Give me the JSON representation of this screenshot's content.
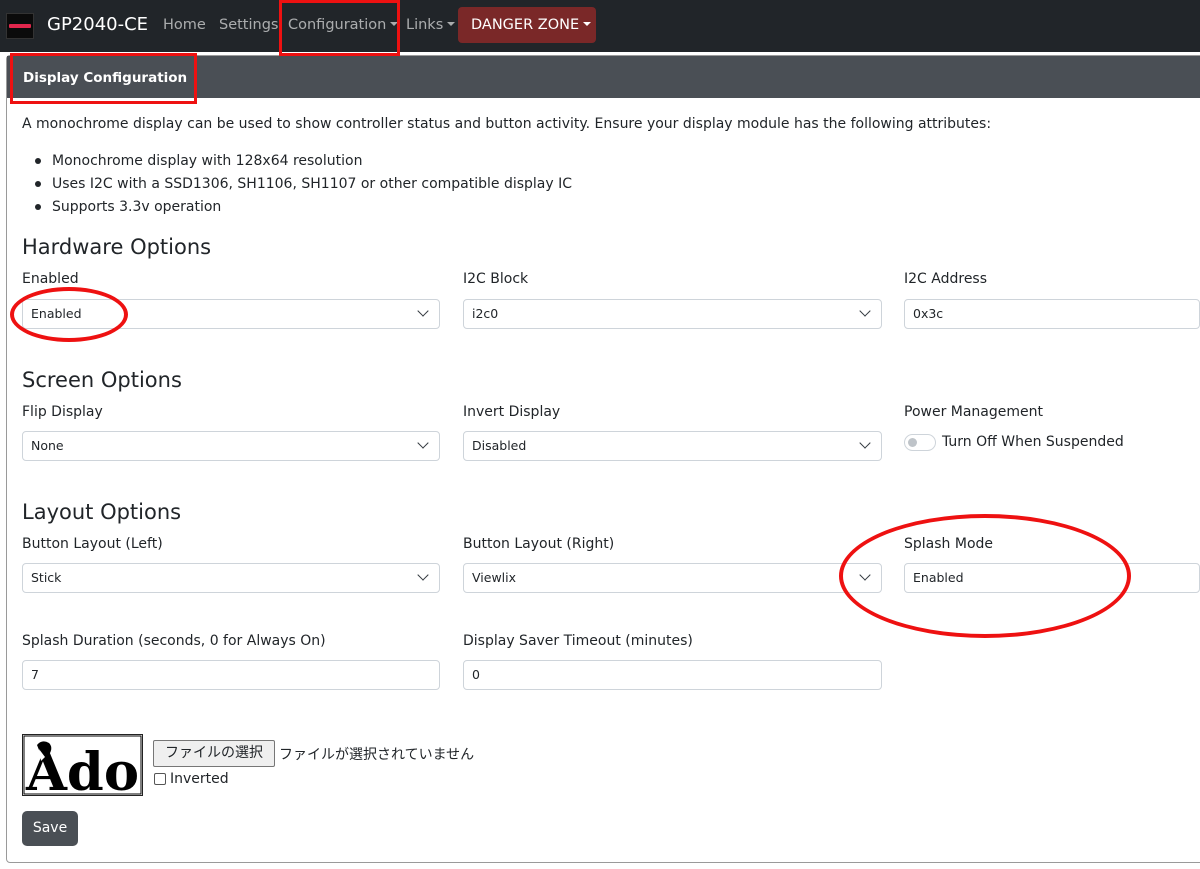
{
  "navbar": {
    "brand": "GP2040-CE",
    "links": [
      "Home",
      "Settings",
      "Configuration",
      "Links"
    ],
    "danger": "DANGER ZONE"
  },
  "card": {
    "title": "Display Configuration",
    "intro": "A monochrome display can be used to show controller status and button activity. Ensure your display module has the following attributes:",
    "bullets": [
      "Monochrome display with 128x64 resolution",
      "Uses I2C with a SSD1306, SH1106, SH1107 or other compatible display IC",
      "Supports 3.3v operation"
    ]
  },
  "hardware": {
    "title": "Hardware Options",
    "enabled_label": "Enabled",
    "enabled_value": "Enabled",
    "block_label": "I2C Block",
    "block_value": "i2c0",
    "address_label": "I2C Address",
    "address_value": "0x3c"
  },
  "screen": {
    "title": "Screen Options",
    "flip_label": "Flip Display",
    "flip_value": "None",
    "invert_label": "Invert Display",
    "invert_value": "Disabled",
    "power_label": "Power Management",
    "power_toggle_label": "Turn Off When Suspended",
    "power_toggle_on": false
  },
  "layout": {
    "title": "Layout Options",
    "left_label": "Button Layout (Left)",
    "left_value": "Stick",
    "right_label": "Button Layout (Right)",
    "right_value": "Viewlix",
    "splash_label": "Splash Mode",
    "splash_value": "Enabled",
    "duration_label": "Splash Duration (seconds, 0 for Always On)",
    "duration_value": "7",
    "saver_label": "Display Saver Timeout (minutes)",
    "saver_value": "0"
  },
  "splash": {
    "image_text": "Ado",
    "file_button": "ファイルの選択",
    "file_status": "ファイルが選択されていません",
    "inverted_label": "Inverted",
    "inverted_checked": false
  },
  "save_label": "Save",
  "colors": {
    "navbar": "#212529",
    "danger": "#7a2828",
    "card_header": "#4a4f55",
    "annotation": "#ee1111"
  }
}
